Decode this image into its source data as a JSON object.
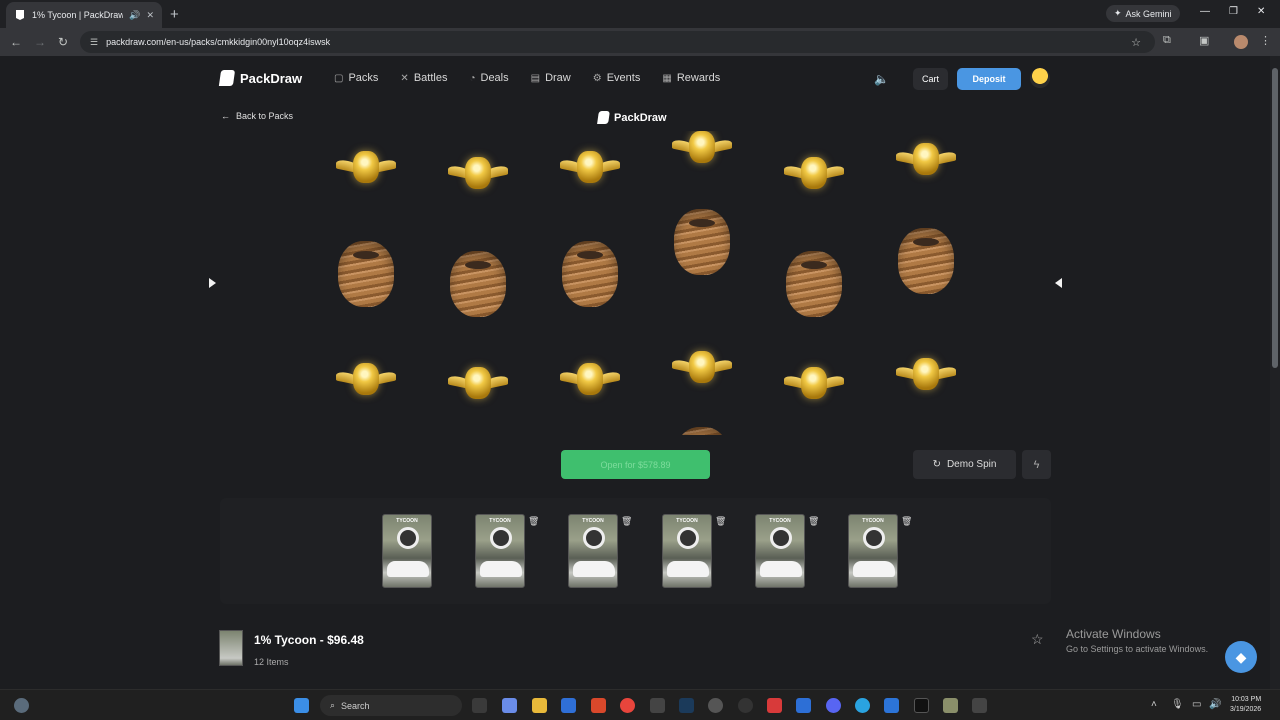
{
  "browser": {
    "tab_title": "1% Tycoon | PackDraw",
    "new_tab_symbol": "+",
    "ask_gemini": "Ask Gemini",
    "url": "packdraw.com/en-us/packs/cmkkidgin00nyl10oqz4iswsk"
  },
  "site": {
    "brand": "PackDraw",
    "nav": [
      "Packs",
      "Battles",
      "Deals",
      "Draw",
      "Events",
      "Rewards"
    ],
    "nav_icons": [
      "cards-icon",
      "swords-icon",
      "tag-icon",
      "draw-icon",
      "calendar-icon",
      "gift-icon"
    ],
    "cart": "Cart",
    "deposit": "Deposit"
  },
  "opener": {
    "back_label": "Back to Packs",
    "center_brand": "PackDraw",
    "open_button": "Open for $578.89",
    "demo_spin": "Demo Spin",
    "reel_count": 6
  },
  "pack_slots": {
    "count": 6,
    "card_title": "TYCOON"
  },
  "pack_info": {
    "name": "1% Tycoon - $96.48",
    "items": "12 Items"
  },
  "overlay": {
    "activate_title": "Activate Windows",
    "activate_sub": "Go to Settings to activate Windows."
  },
  "taskbar": {
    "search": "Search",
    "time": "10:03 PM",
    "date": "3/19/2026"
  },
  "colors": {
    "deposit": "#4a96e2",
    "open_button": "#3fbf6e",
    "page_bg": "#1c1d20"
  }
}
